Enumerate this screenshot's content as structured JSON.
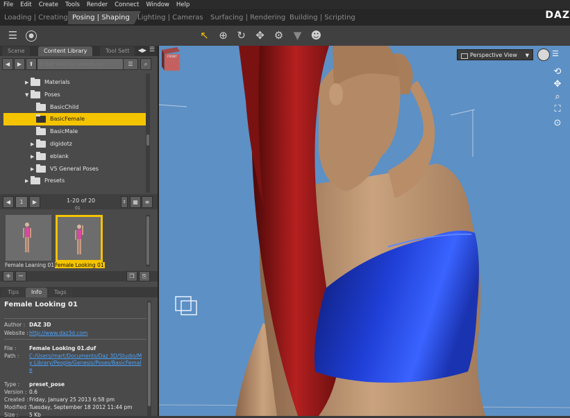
{
  "menubar": [
    "File",
    "Edit",
    "Create",
    "Tools",
    "Render",
    "Connect",
    "Window",
    "Help"
  ],
  "activity_tabs": [
    {
      "label": "Loading | Creating",
      "active": false
    },
    {
      "label": "Posing | Shaping",
      "active": true
    },
    {
      "label": "Lighting | Cameras",
      "active": false
    },
    {
      "label": "Surfacing | Rendering",
      "active": false
    },
    {
      "label": "Building | Scripting",
      "active": false
    }
  ],
  "logo": "DAZ",
  "toolbar": {
    "icons": [
      "pane-menu-icon",
      "tool-settings-icon",
      "pointer-icon",
      "universal-tool-icon",
      "rotate-icon",
      "translate-icon",
      "joint-editor-icon",
      "filter-icon",
      "figure-icon"
    ]
  },
  "panel_tabs": [
    "Scene",
    "Content Library",
    "Tool Sett"
  ],
  "search": {
    "placeholder": "Enter text to search by"
  },
  "tree": [
    {
      "label": "Materials",
      "indent": 1,
      "arrow": "▶",
      "selected": false
    },
    {
      "label": "Poses",
      "indent": 1,
      "arrow": "▼",
      "selected": false
    },
    {
      "label": "BasicChild",
      "indent": 2,
      "arrow": "",
      "selected": false
    },
    {
      "label": "BasicFemale",
      "indent": 2,
      "arrow": "",
      "selected": true
    },
    {
      "label": "BasicMale",
      "indent": 2,
      "arrow": "",
      "selected": false
    },
    {
      "label": "digidotz",
      "indent": 2,
      "arrow": "▶",
      "selected": false
    },
    {
      "label": "eblank",
      "indent": 2,
      "arrow": "▶",
      "selected": false
    },
    {
      "label": "V5 General Poses",
      "indent": 2,
      "arrow": "▶",
      "selected": false
    },
    {
      "label": "Presets",
      "indent": 1,
      "arrow": "▶",
      "selected": false
    }
  ],
  "pager": {
    "page": "1",
    "range": "1-20 of 20",
    "sub": "01"
  },
  "thumbnails": [
    {
      "label": "Female Leaning 01",
      "selected": false
    },
    {
      "label": "Female Looking 01",
      "selected": true
    }
  ],
  "info_tabs": [
    "Tips",
    "Info",
    "Tags"
  ],
  "info": {
    "title": "Female Looking 01",
    "author_label": "Author :",
    "author": "DAZ 3D",
    "website_label": "Website :",
    "website": "http://www.daz3d.com",
    "file_label": "File :",
    "file": "Female Looking 01.duf",
    "path_label": "Path :",
    "path": "C:/Users/mart/Documents/Daz 3D/Studio/My Library/People/Genesis/Poses/BasicFemale",
    "type_label": "Type :",
    "type": "preset_pose",
    "version_label": "Version :",
    "version": "0.6",
    "created_label": "Created :",
    "created": "Friday, January 25 2013 6:58 pm",
    "modified_label": "Modified :",
    "modified": "Tuesday, September 18 2012 11:44 pm",
    "size_label": "Size :",
    "size": "5 Kb"
  },
  "viewport": {
    "view": "Perspective View",
    "cube_label": "FRONT",
    "colors": {
      "bg": "#5d90c4",
      "top": "#1f3fd6",
      "hair": "#9e1b1b",
      "skin": "#c8a27e"
    }
  }
}
